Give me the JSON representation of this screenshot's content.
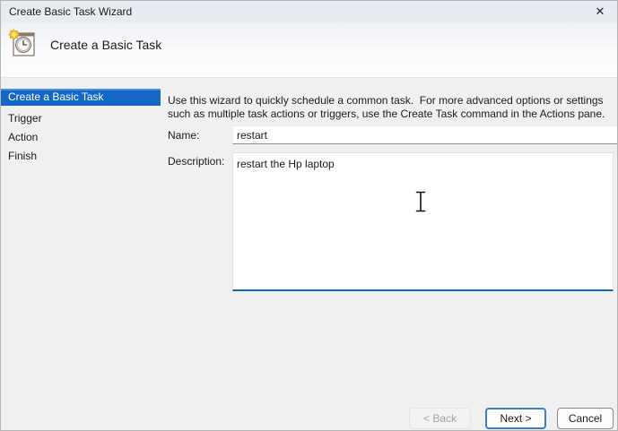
{
  "window": {
    "title": "Create Basic Task Wizard",
    "close_glyph": "✕"
  },
  "header": {
    "title": "Create a Basic Task",
    "icon": "task-scheduler-wizard-icon"
  },
  "sidebar": {
    "items": [
      {
        "label": "Create a Basic Task",
        "selected": true
      },
      {
        "label": "Trigger",
        "selected": false
      },
      {
        "label": "Action",
        "selected": false
      },
      {
        "label": "Finish",
        "selected": false
      }
    ]
  },
  "main": {
    "intro": "Use this wizard to quickly schedule a common task.  For more advanced options or settings such as multiple task actions or triggers, use the Create Task command in the Actions pane.",
    "name_label": "Name:",
    "name_value": "restart",
    "description_label": "Description:",
    "description_value": "restart the Hp laptop"
  },
  "footer": {
    "back_label": "< Back",
    "next_label": "Next >",
    "cancel_label": "Cancel"
  },
  "colors": {
    "selection_blue": "#1467c5",
    "selection_top_edge": "#4a90e0",
    "focus_accent": "#1064b8",
    "next_button_border": "#3d7fc1",
    "content_background": "#f0f0f0",
    "titlebar_background": "#e8ebf1"
  }
}
